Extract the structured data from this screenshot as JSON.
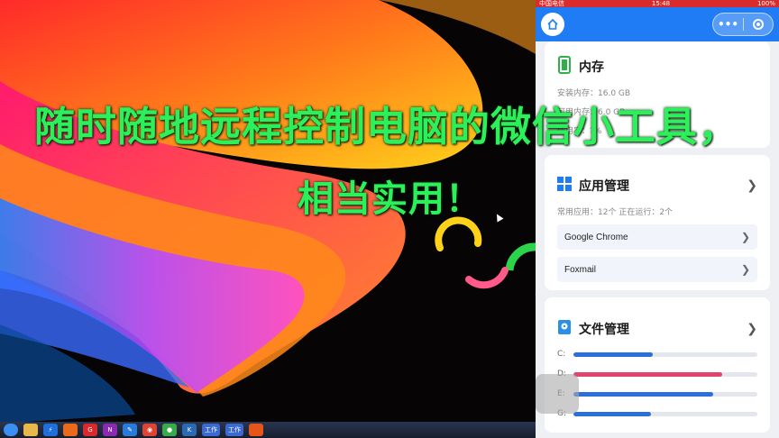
{
  "overlay": {
    "headline": "随时随地远程控制电脑的微信小工具，",
    "subline": "相当实用！"
  },
  "desktop": {
    "taskbar_icons": [
      "start-orb-icon",
      "file-explorer-icon",
      "thunder-icon",
      "swirl-app-icon",
      "red-g-app-icon",
      "onenote-icon",
      "pen-app-icon",
      "chrome-icon",
      "green-app-icon",
      "k-app-icon",
      "doc-app-icon",
      "doc-app-icon-2",
      "orange-app-icon"
    ],
    "taskbar_labels": {
      "doc1": "工作",
      "doc2": "工作"
    }
  },
  "phone": {
    "status": {
      "carrier": "中国电信",
      "time": "15:48",
      "battery": "100%"
    },
    "nav": {
      "more": "•••"
    },
    "memory": {
      "title": "内存",
      "installed": "安装内存：16.0 GB",
      "available": "可用内存：6.0 GB",
      "usage": "使用率：?%"
    },
    "apps": {
      "title": "应用管理",
      "summary": "常用应用：12个   正在运行：2个",
      "items": [
        {
          "name": "Google Chrome"
        },
        {
          "name": "Foxmail"
        }
      ]
    },
    "files": {
      "title": "文件管理",
      "disks": [
        {
          "label": "C:",
          "used": 0.43,
          "color": "#2a6fdc"
        },
        {
          "label": "D:",
          "used": 0.81,
          "color": "#e0456b"
        },
        {
          "label": "E:",
          "used": 0.76,
          "color": "#2a6fdc"
        },
        {
          "label": "G:",
          "used": 0.42,
          "color": "#2a6fdc"
        }
      ]
    }
  }
}
